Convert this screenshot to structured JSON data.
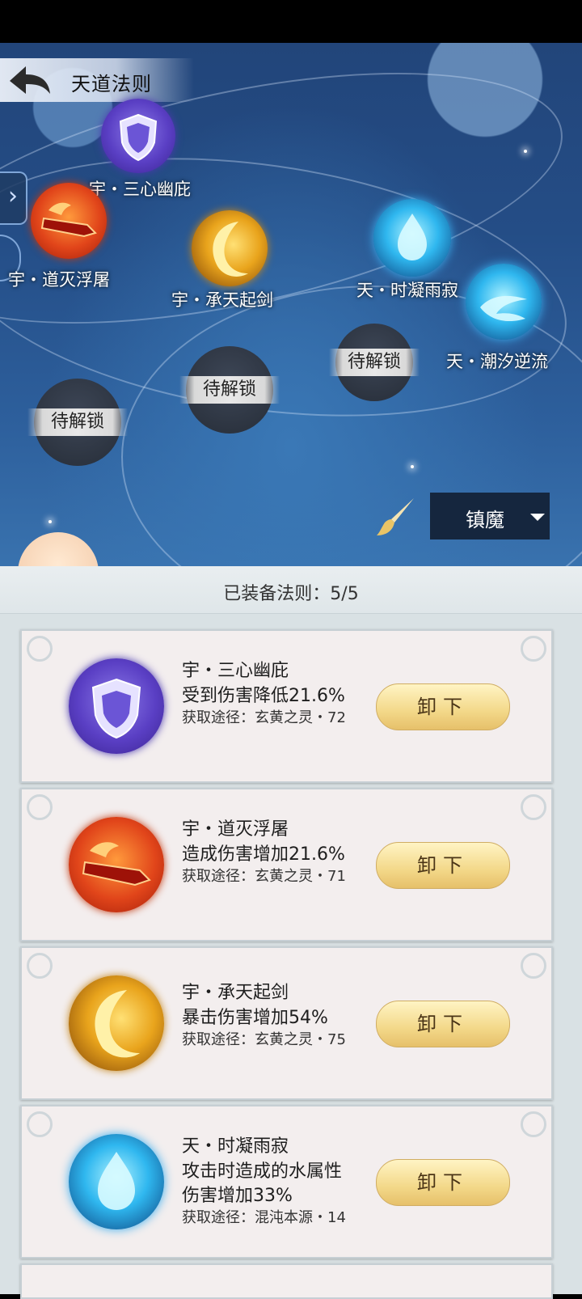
{
  "header": {
    "title": "天道法则",
    "back_icon": "back-arrow-icon"
  },
  "map": {
    "nodes": [
      {
        "label": "宇・三心幽庇",
        "icon": "shield-icon"
      },
      {
        "label": "宇・道灭浮屠",
        "icon": "fire-sword-icon"
      },
      {
        "label": "宇・承天起剑",
        "icon": "golden-crescent-icon"
      },
      {
        "label": "天・时凝雨寂",
        "icon": "water-drop-icon"
      },
      {
        "label": "天・潮汐逆流",
        "icon": "water-swirl-icon"
      }
    ],
    "locked_label": "待解锁",
    "mode": {
      "selected": "镇魔"
    },
    "brush_icon": "brush-icon"
  },
  "panel": {
    "equipped_text": "已装备法则：5/5",
    "cards": [
      {
        "name": "宇・三心幽庇",
        "desc": "受到伤害降低21.6%",
        "source": "获取途径：玄黄之灵・72",
        "button": "卸下",
        "icon": "shield-icon"
      },
      {
        "name": "宇・道灭浮屠",
        "desc": "造成伤害增加21.6%",
        "source": "获取途径：玄黄之灵・71",
        "button": "卸下",
        "icon": "fire-sword-icon"
      },
      {
        "name": "宇・承天起剑",
        "desc": "暴击伤害增加54%",
        "source": "获取途径：玄黄之灵・75",
        "button": "卸下",
        "icon": "golden-crescent-icon"
      },
      {
        "name": "天・时凝雨寂",
        "desc": "攻击时造成的水属性伤害增加33%",
        "source": "获取途径：混沌本源・14",
        "button": "卸下",
        "icon": "water-drop-icon"
      }
    ]
  }
}
